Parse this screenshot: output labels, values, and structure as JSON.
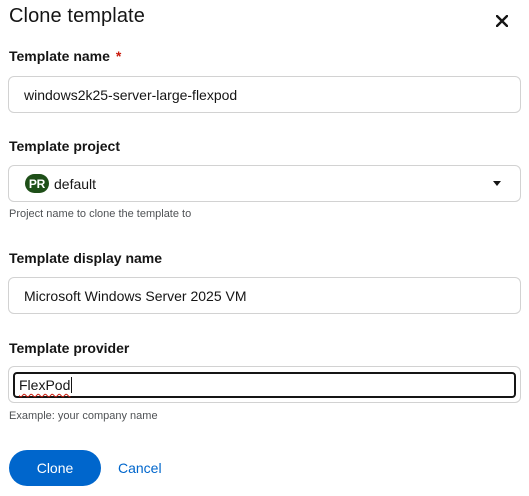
{
  "dialog": {
    "title": "Clone template",
    "close_icon": "close-icon"
  },
  "fields": {
    "template_name": {
      "label": "Template name",
      "required_marker": "*",
      "value": "windows2k25-server-large-flexpod"
    },
    "template_project": {
      "label": "Template project",
      "badge": "PR",
      "value": "default",
      "helper": "Project name to clone the template to"
    },
    "template_display_name": {
      "label": "Template display name",
      "value": "Microsoft Windows Server 2025 VM"
    },
    "template_provider": {
      "label": "Template provider",
      "value": "FlexPod",
      "helper": "Example: your company name"
    }
  },
  "actions": {
    "clone_label": "Clone",
    "cancel_label": "Cancel"
  },
  "colors": {
    "primary": "#0066cc",
    "required": "#c9190b",
    "badge_bg": "#1e4f18"
  }
}
